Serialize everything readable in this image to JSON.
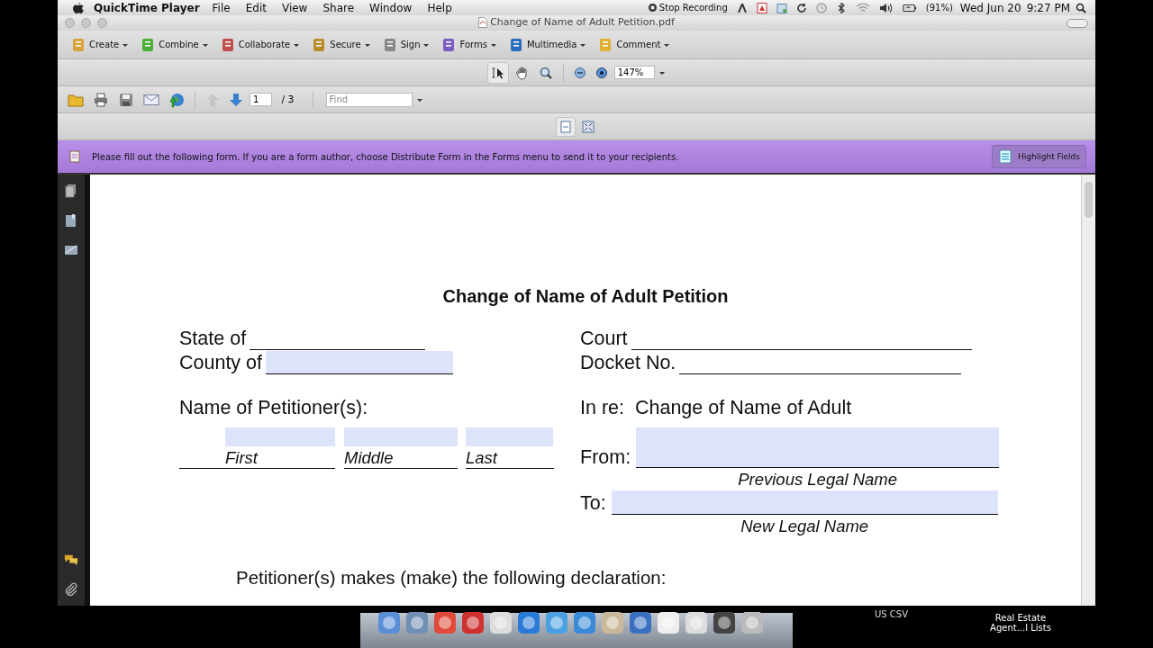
{
  "menubar": {
    "app": "QuickTime Player",
    "menus": [
      "File",
      "Edit",
      "View",
      "Share",
      "Window",
      "Help"
    ],
    "recording": "Stop Recording",
    "battery": "(91%)",
    "date": "Wed Jun 20",
    "time": "9:27 PM"
  },
  "window": {
    "title": "Change of Name of Adult Petition.pdf"
  },
  "tasks": [
    "Create",
    "Combine",
    "Collaborate",
    "Secure",
    "Sign",
    "Forms",
    "Multimedia",
    "Comment"
  ],
  "view_tools": {
    "zoom": "147%"
  },
  "nav": {
    "page": "1",
    "total": "/ 3",
    "find_placeholder": "Find"
  },
  "form_bar": {
    "message": "Please fill out the following form. If you are a form author, choose Distribute Form in the Forms menu to send it to your recipients.",
    "button": "Highlight Fields"
  },
  "document": {
    "title": "Change of Name of Adult Petition",
    "left": [
      {
        "label": "State of",
        "kind": "line"
      },
      {
        "label": "County of",
        "kind": "field"
      }
    ],
    "right": [
      {
        "label": "Court",
        "kind": "line"
      },
      {
        "label": "Docket No.",
        "kind": "line"
      }
    ],
    "petitioner_label": "Name of Petitioner(s):",
    "name_parts": [
      {
        "caption": "First",
        "kind": "field"
      },
      {
        "caption": "Middle",
        "kind": "field"
      },
      {
        "caption": "Last",
        "kind": "field"
      }
    ],
    "in_re": "In re:  Change of Name of Adult",
    "from": {
      "label": "From:",
      "caption": "Previous Legal Name",
      "kind": "field"
    },
    "to": {
      "label": "To:",
      "caption": "New Legal Name",
      "kind": "field"
    },
    "declaration": "Petitioner(s) makes (make) the following declaration:"
  },
  "desktop": {
    "items": [
      "US CSV",
      "Real Estate Agent...l Lists"
    ]
  }
}
